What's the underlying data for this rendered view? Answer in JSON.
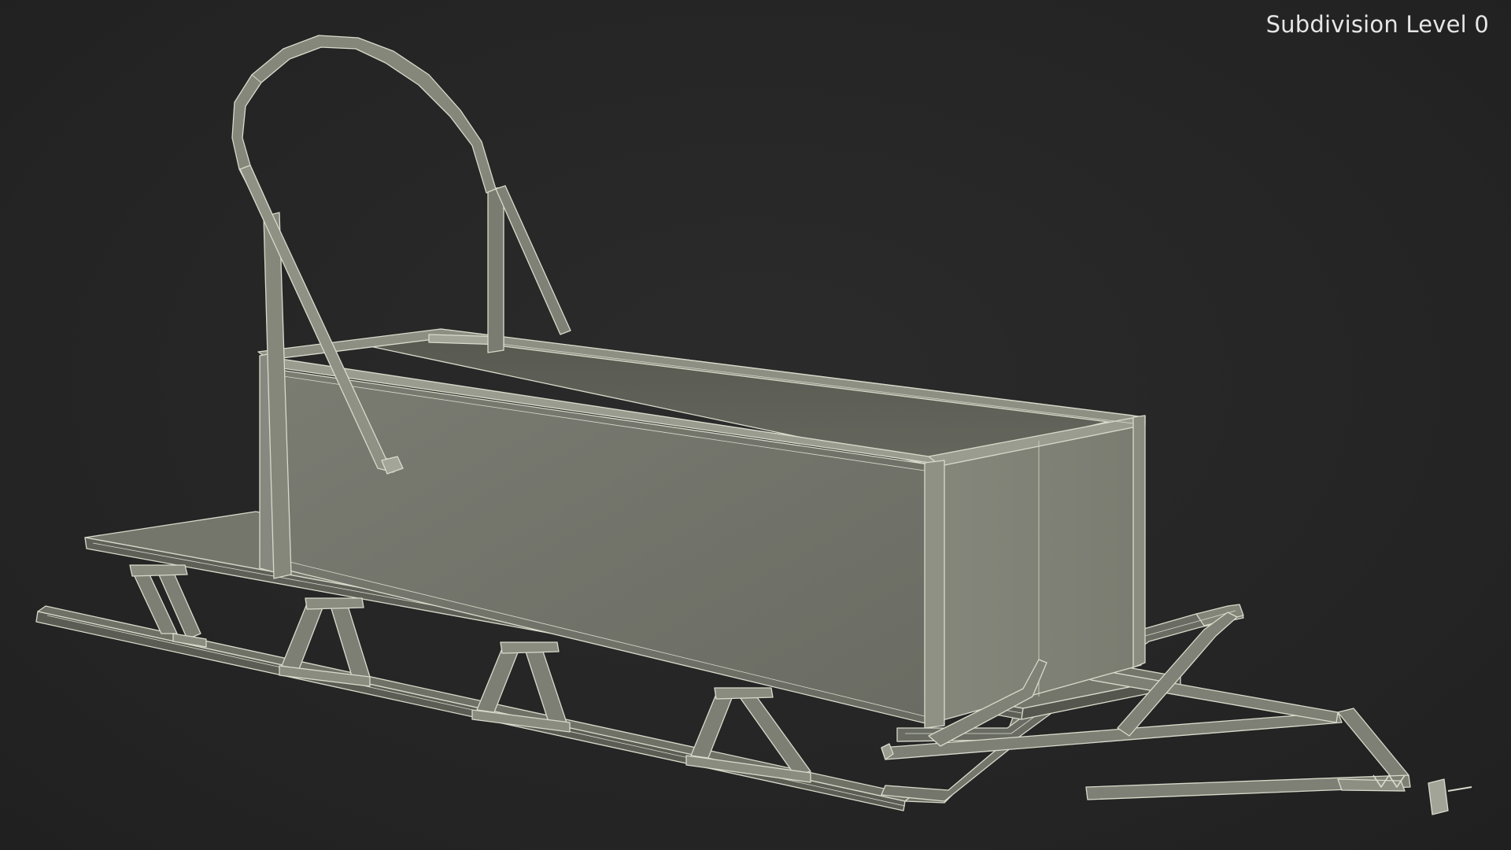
{
  "viewport": {
    "caption": "Subdivision Level 0"
  },
  "model": {
    "subject": "sled",
    "render_mode": "wireframe-on-shaded",
    "colors": {
      "background": "#262626",
      "surface_light": "#8a8c80",
      "surface_mid": "#6e7066",
      "surface_dark": "#55574f",
      "wire": "#d8dacb",
      "text": "#e6e6e6"
    }
  }
}
